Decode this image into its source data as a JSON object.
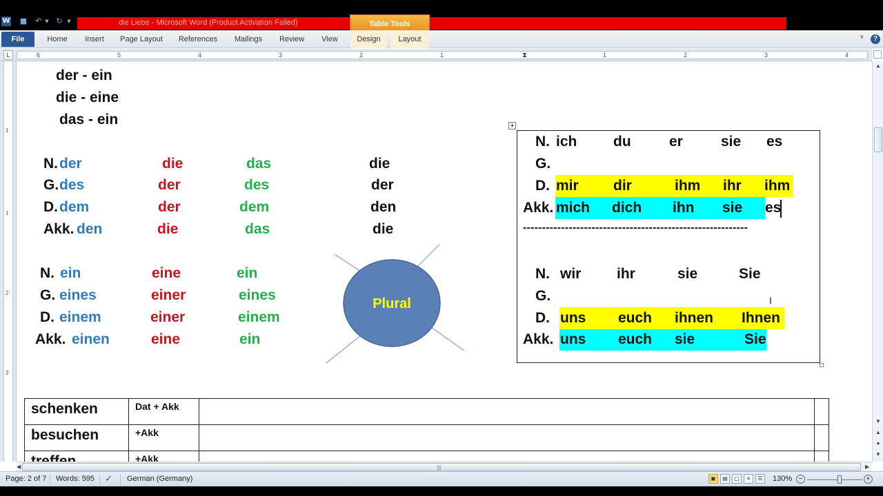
{
  "window": {
    "title": "die Liebe  -  Microsoft Word (Product Activation Failed)",
    "context_tab_group": "Table Tools"
  },
  "ribbon": {
    "tabs": [
      "File",
      "Home",
      "Insert",
      "Page Layout",
      "References",
      "Mailings",
      "Review",
      "View",
      "Design",
      "Layout"
    ]
  },
  "ruler": {
    "numbers": [
      "6",
      "5",
      "4",
      "3",
      "2",
      "1",
      "1",
      "1",
      "2",
      "3",
      "4"
    ]
  },
  "doc": {
    "articles": [
      "der -   ein",
      "die  -   eine",
      "das   -  ein"
    ],
    "definite": {
      "labels": [
        "N.",
        "G.",
        "D.",
        "Akk."
      ],
      "masc": [
        "der",
        "des",
        "dem",
        "den"
      ],
      "fem": [
        "die",
        "der",
        "der",
        "die"
      ],
      "neut": [
        "das",
        "des",
        "dem",
        "das"
      ],
      "plural": [
        "die",
        "der",
        "den",
        "die"
      ]
    },
    "indefinite": {
      "labels": [
        "N.",
        "G.",
        "D.",
        "Akk."
      ],
      "masc": [
        "ein",
        "eines",
        "einem",
        "einen"
      ],
      "fem": [
        "eine",
        "einer",
        "einer",
        "eine"
      ],
      "neut": [
        "ein",
        "eines",
        "einem",
        "ein"
      ]
    },
    "shape_label": "Plural",
    "pronouns": {
      "singular": {
        "labels": [
          "N.",
          "G.",
          "D.",
          "Akk."
        ],
        "nominative": [
          "ich",
          "du",
          "er",
          "sie",
          "es"
        ],
        "dative": [
          "mir",
          "dir",
          "ihm",
          "ihr",
          "ihm"
        ],
        "accusative": [
          "mich",
          "dich",
          "ihn",
          "sie",
          "es"
        ]
      },
      "separator": "-----------------------------------------------------------",
      "plural": {
        "labels": [
          "N.",
          "G.",
          "D.",
          "Akk."
        ],
        "nominative": [
          "wir",
          "ihr",
          "sie",
          "Sie"
        ],
        "dative": [
          "uns",
          "euch",
          "ihnen",
          "Ihnen"
        ],
        "accusative": [
          "uns",
          "euch",
          "sie",
          "Sie"
        ]
      }
    },
    "verbs": [
      {
        "verb": "schenken",
        "case": "Dat + Akk"
      },
      {
        "verb": "besuchen",
        "case": "+Akk"
      },
      {
        "verb": "treffen",
        "case": "+Akk"
      }
    ]
  },
  "status": {
    "page": "Page: 2 of 7",
    "words": "Words: 595",
    "language": "German (Germany)",
    "zoom": "130%"
  },
  "colors": {
    "masculine": "#2f7cc0",
    "feminine": "#c8141e",
    "neuter": "#23b04c",
    "highlight_yellow": "#ffff00",
    "highlight_cyan": "#00ffff",
    "shape_fill": "#5b80b7",
    "shape_text": "#ffff00",
    "title_bar": "#e60000"
  }
}
